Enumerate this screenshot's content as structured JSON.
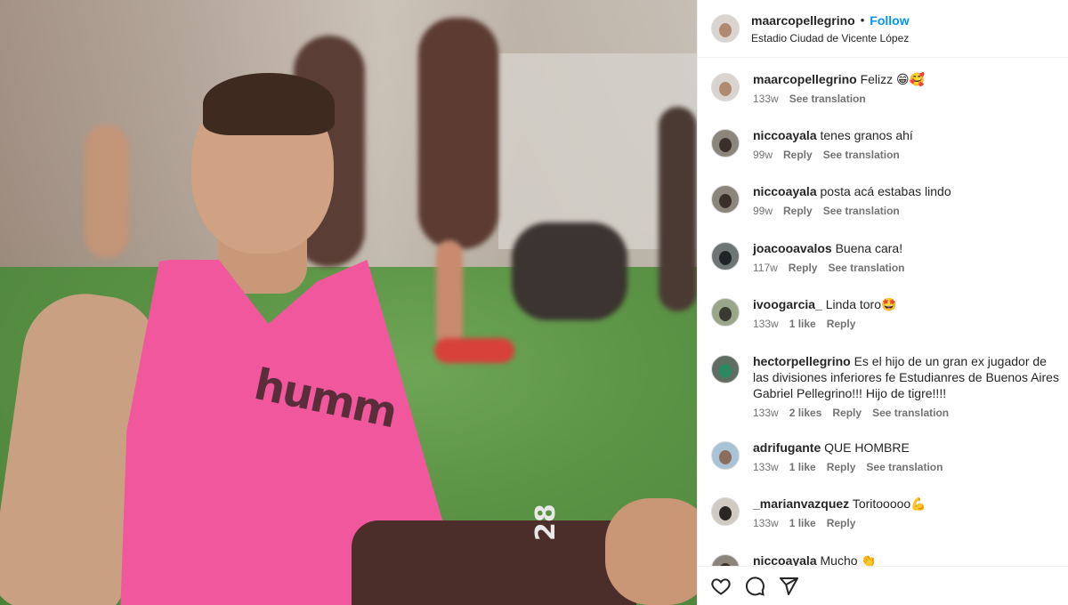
{
  "post": {
    "username": "maarcopellegrino",
    "dot": "•",
    "follow_label": "Follow",
    "location": "Estadio Ciudad de Vicente López",
    "image": {
      "vest_text": "humm",
      "shorts_number": "28"
    }
  },
  "comments": [
    {
      "user": "maarcopellegrino",
      "text": "Felizz 😁🥰",
      "age": "133w",
      "likes": "",
      "reply": "",
      "translate": "See translation",
      "avatar_bg": "#d9d4cf",
      "face": "#b08a70"
    },
    {
      "user": "niccoayala",
      "text": "tenes granos ahí",
      "age": "99w",
      "likes": "",
      "reply": "Reply",
      "translate": "See translation",
      "avatar_bg": "#8c857c",
      "face": "#3b3029"
    },
    {
      "user": "niccoayala",
      "text": "posta acá estabas lindo",
      "age": "99w",
      "likes": "",
      "reply": "Reply",
      "translate": "See translation",
      "avatar_bg": "#8c857c",
      "face": "#3b3029"
    },
    {
      "user": "joacooavalos",
      "text": "Buena cara!",
      "age": "117w",
      "likes": "",
      "reply": "Reply",
      "translate": "See translation",
      "avatar_bg": "#6e7575",
      "face": "#1f2526"
    },
    {
      "user": "ivoogarcia_",
      "text": "Linda toro🤩",
      "age": "133w",
      "likes": "1 like",
      "reply": "Reply",
      "translate": "",
      "avatar_bg": "#9aa58a",
      "face": "#3a3a30"
    },
    {
      "user": "hectorpellegrino",
      "text": "Es el hijo de un gran ex jugador de las divisiones inferiores fe Estudianres de Buenos Aires Gabriel Pellegrino!!! Hijo de tigre!!!!",
      "age": "133w",
      "likes": "2 likes",
      "reply": "Reply",
      "translate": "See translation",
      "avatar_bg": "#5f6d62",
      "face": "#2c8a60"
    },
    {
      "user": "adrifugante",
      "text": "QUE HOMBRE",
      "age": "133w",
      "likes": "1 like",
      "reply": "Reply",
      "translate": "See translation",
      "avatar_bg": "#a9c3d6",
      "face": "#8a6d5a"
    },
    {
      "user": "_marianvazquez",
      "text": "Toritooooo💪",
      "age": "133w",
      "likes": "1 like",
      "reply": "Reply",
      "translate": "",
      "avatar_bg": "#cfcac2",
      "face": "#2a2623"
    },
    {
      "user": "niccoayala",
      "text": "Mucho 👏",
      "age": "",
      "likes": "",
      "reply": "",
      "translate": "",
      "avatar_bg": "#8c857c",
      "face": "#3b3029"
    }
  ],
  "actions": {
    "like_icon": "heart-icon",
    "comment_icon": "comment-icon",
    "share_icon": "send-icon"
  }
}
